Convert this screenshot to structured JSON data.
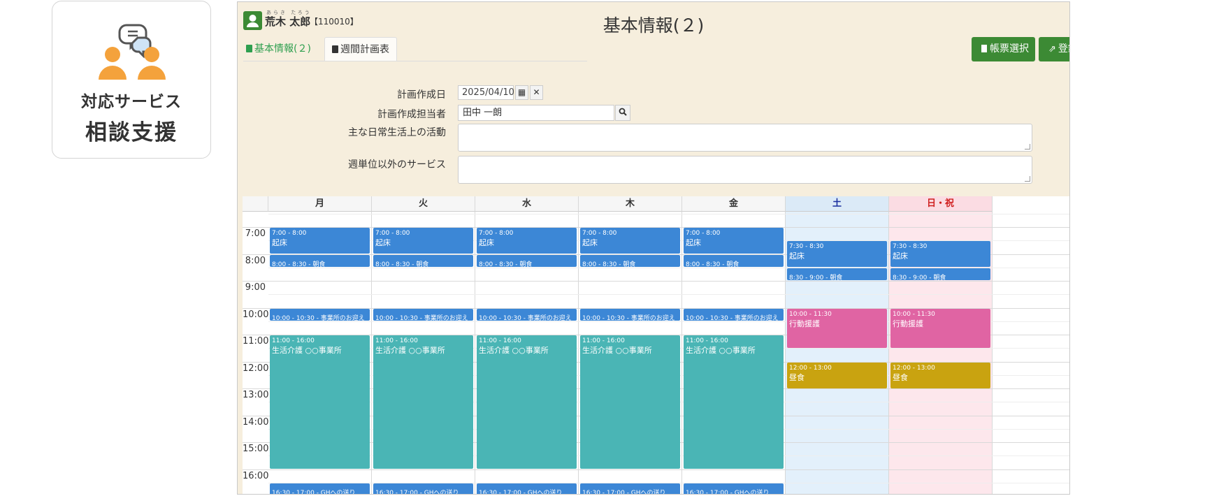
{
  "service_card": {
    "subtitle": "対応サービス",
    "title": "相談支援"
  },
  "app": {
    "user": {
      "ruby": "あらき たろう",
      "name": "荒木 太郎",
      "id": "【110010】"
    },
    "page_title": "基本情報(２)",
    "tabs": [
      {
        "label": "基本情報(２)",
        "active": true
      },
      {
        "label": "週間計画表",
        "active": false
      }
    ],
    "buttons": {
      "report": "帳票選択",
      "register": "登録"
    },
    "form": {
      "plan_date_label": "計画作成日",
      "plan_date_value": "2025/04/10",
      "plan_person_label": "計画作成担当者",
      "plan_person_value": "田中 一朗",
      "daily_activity_label": "主な日常生活上の活動",
      "non_weekly_label": "週単位以外のサービス"
    },
    "colors": {
      "blue": "#3c87d6",
      "teal": "#4ab5b5",
      "pink": "#e064a3",
      "gold": "#c9a310",
      "green": "#3c8a34"
    }
  },
  "calendar": {
    "days": [
      "月",
      "火",
      "水",
      "木",
      "金",
      "土",
      "日・祝"
    ],
    "times": [
      "7:00",
      "8:00",
      "9:00",
      "10:00",
      "11:00",
      "12:00",
      "13:00",
      "14:00",
      "15:00",
      "16:00"
    ],
    "weekday_events": [
      {
        "start": 7.0,
        "end": 8.0,
        "time": "7:00 - 8:00",
        "title": "起床",
        "color": "blue",
        "style": "block"
      },
      {
        "start": 8.0,
        "end": 8.5,
        "time": "8:00 - 8:30",
        "title": "朝食",
        "color": "blue",
        "style": "inline"
      },
      {
        "start": 10.0,
        "end": 10.5,
        "time": "10:00 - 10:30",
        "title": "事業所のお迎え",
        "color": "blue",
        "style": "inline"
      },
      {
        "start": 11.0,
        "end": 16.0,
        "time": "11:00 - 16:00",
        "title": "生活介護 ○○事業所",
        "color": "teal",
        "style": "block"
      },
      {
        "start": 16.5,
        "end": 17.0,
        "time": "16:30 - 17:00",
        "title": "GHへの送り",
        "color": "blue",
        "style": "inline"
      }
    ],
    "weekend_events": [
      {
        "start": 7.5,
        "end": 8.5,
        "time": "7:30 - 8:30",
        "title": "起床",
        "color": "blue",
        "style": "block"
      },
      {
        "start": 8.5,
        "end": 9.0,
        "time": "8:30 - 9:00",
        "title": "朝食",
        "color": "blue",
        "style": "inline"
      },
      {
        "start": 10.0,
        "end": 11.5,
        "time": "10:00 - 11:30",
        "title": "行動援護",
        "color": "pink",
        "style": "block"
      },
      {
        "start": 12.0,
        "end": 13.0,
        "time": "12:00 - 13:00",
        "title": "昼食",
        "color": "gold",
        "style": "block"
      }
    ]
  }
}
